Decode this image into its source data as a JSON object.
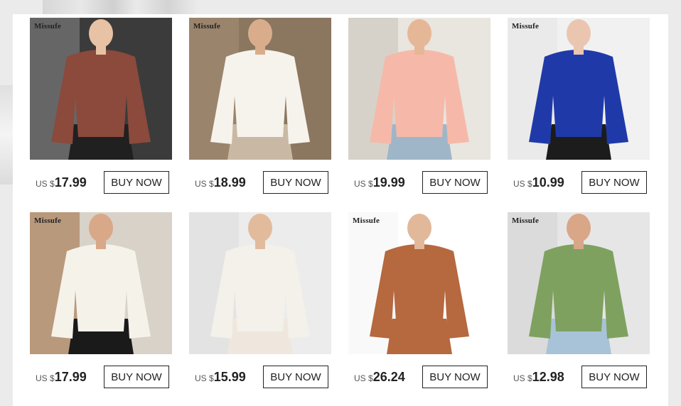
{
  "products": [
    {
      "brand": "Missufe",
      "currency": "US $",
      "price": "17.99",
      "button": "BUY NOW",
      "colors": {
        "bg": "#3b3b3b",
        "bg2": "#8a8a8a",
        "garment": "#8b4a3c",
        "skin": "#e8c2a4",
        "pants": "#202020"
      }
    },
    {
      "brand": "Missufe",
      "currency": "US $",
      "price": "18.99",
      "button": "BUY NOW",
      "colors": {
        "bg": "#8b7660",
        "bg2": "#a99076",
        "garment": "#f6f3ec",
        "skin": "#d9ad8c",
        "pants": "#c9b9a4"
      }
    },
    {
      "brand": "",
      "currency": "US $",
      "price": "19.99",
      "button": "BUY NOW",
      "colors": {
        "bg": "#e9e5df",
        "bg2": "#c7c2b7",
        "garment": "#f6b9a9",
        "skin": "#e5b797",
        "pants": "#9fb6c9"
      }
    },
    {
      "brand": "Missufe",
      "currency": "US $",
      "price": "10.99",
      "button": "BUY NOW",
      "colors": {
        "bg": "#f1f1f1",
        "bg2": "#e4e4e4",
        "garment": "#1f3aa8",
        "skin": "#eac6b0",
        "pants": "#1c1c1c"
      }
    },
    {
      "brand": "Missufe",
      "currency": "US $",
      "price": "17.99",
      "button": "BUY NOW",
      "colors": {
        "bg": "#d8d2c8",
        "bg2": "#a06a3c",
        "garment": "#f5f2ea",
        "skin": "#d8a888",
        "pants": "#1a1a1a"
      }
    },
    {
      "brand": "",
      "currency": "US $",
      "price": "15.99",
      "button": "BUY NOW",
      "colors": {
        "bg": "#ececec",
        "bg2": "#dcdcdc",
        "garment": "#f3f1ea",
        "skin": "#e2bb9c",
        "pants": "#efe7dd"
      }
    },
    {
      "brand": "Missufe",
      "currency": "US $",
      "price": "26.24",
      "button": "BUY NOW",
      "colors": {
        "bg": "#ffffff",
        "bg2": "#f4f4f4",
        "garment": "#b6683e",
        "skin": "#e2b89a",
        "pants": "#b6683e"
      }
    },
    {
      "brand": "Missufe",
      "currency": "US $",
      "price": "12.98",
      "button": "BUY NOW",
      "colors": {
        "bg": "#e6e6e6",
        "bg2": "#d2d2d2",
        "garment": "#7fa15f",
        "skin": "#d9a688",
        "pants": "#a8c3d8"
      }
    }
  ]
}
